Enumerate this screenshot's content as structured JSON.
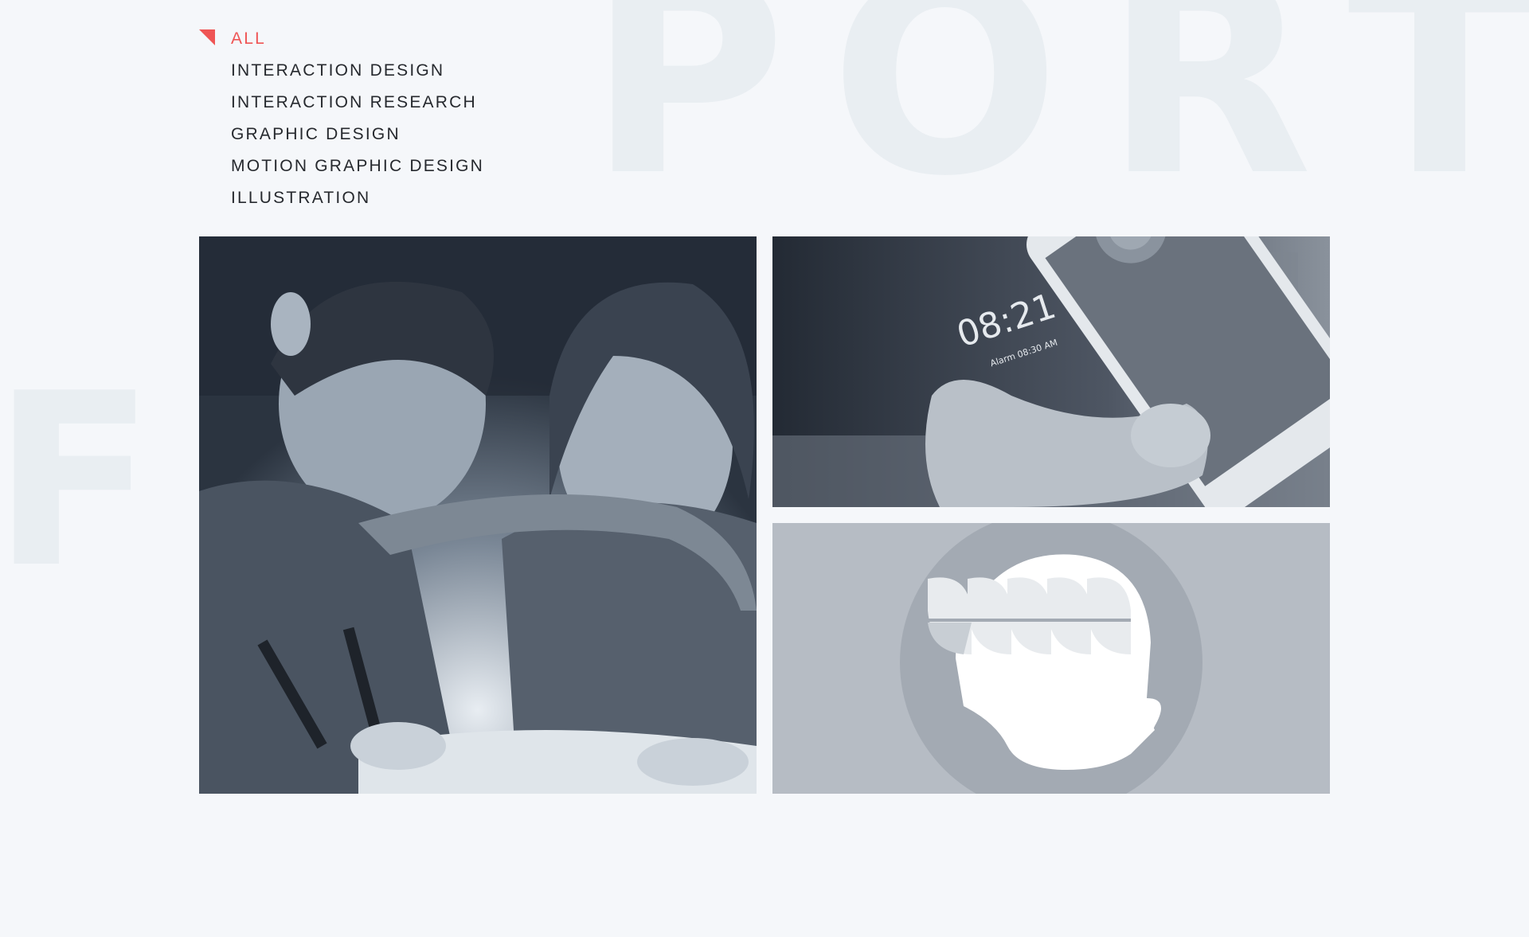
{
  "background": {
    "watermark_top": "POR",
    "watermark_top_right": "T",
    "watermark_left": "FO"
  },
  "filters": {
    "active": "ALL",
    "items": [
      "ALL",
      "INTERACTION DESIGN",
      "INTERACTION RESEARCH",
      "GRAPHIC DESIGN",
      "MOTION GRAPHIC DESIGN",
      "ILLUSTRATION"
    ]
  },
  "projects": [
    {
      "name": "children-light-table"
    },
    {
      "name": "alarm-clock-app",
      "screen_time": "08:21",
      "screen_alarm": "Alarm 08:30 AM"
    },
    {
      "name": "leaf-head-illustration"
    }
  ],
  "colors": {
    "accent": "#ef5555",
    "text": "#26292e",
    "background": "#f5f7fa",
    "watermark": "#e9eef2"
  }
}
